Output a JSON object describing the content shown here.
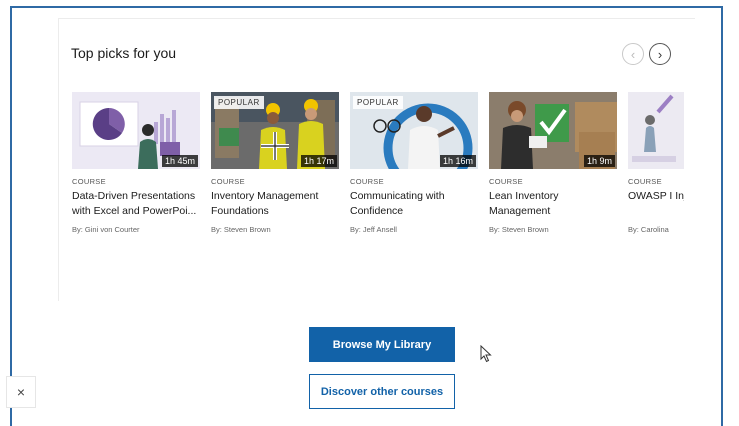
{
  "section": {
    "title": "Top picks for you"
  },
  "carousel": {
    "prev_icon": "chevron-left-icon",
    "next_icon": "chevron-right-icon",
    "prev_glyph": "‹",
    "next_glyph": "›"
  },
  "courses": [
    {
      "type": "COURSE",
      "title": "Data-Driven Presentations with Excel and PowerPoi...",
      "author": "By: Gini von Courter",
      "duration": "1h 45m",
      "badge": ""
    },
    {
      "type": "COURSE",
      "title": "Inventory Management Foundations",
      "author": "By: Steven Brown",
      "duration": "1h 17m",
      "badge": "POPULAR"
    },
    {
      "type": "COURSE",
      "title": "Communicating with Confidence",
      "author": "By: Jeff Ansell",
      "duration": "1h 16m",
      "badge": "POPULAR"
    },
    {
      "type": "COURSE",
      "title": "Lean Inventory Management",
      "author": "By: Steven Brown",
      "duration": "1h 9m",
      "badge": ""
    },
    {
      "type": "COURSE",
      "title": "OWASP I Injection",
      "author": "By: Carolina",
      "duration": "",
      "badge": ""
    }
  ],
  "actions": {
    "browse_label": "Browse My Library",
    "discover_label": "Discover other courses"
  },
  "close": {
    "glyph": "×"
  },
  "colors": {
    "primary": "#1262a8",
    "frame_border": "#2f6aa5"
  }
}
